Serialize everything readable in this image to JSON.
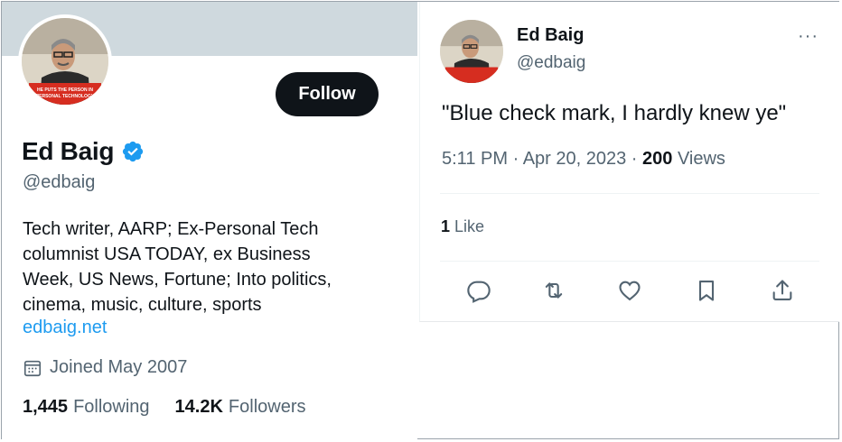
{
  "profile": {
    "name": "Ed Baig",
    "handle": "@edbaig",
    "follow_label": "Follow",
    "bio_lines": [
      "Tech writer, AARP; Ex-Personal Tech",
      "columnist USA TODAY, ex Business",
      "Week, US News, Fortune; Into politics,",
      "cinema, music, culture, sports"
    ],
    "website": "edbaig.net",
    "joined": "Joined May 2007",
    "following_count": "1,445",
    "following_label": "Following",
    "followers_count": "14.2K",
    "followers_label": "Followers",
    "avatar_caption": "HE PUTS THE PERSON IN PERSONAL TECHNOLOGY"
  },
  "tweet": {
    "name": "Ed Baig",
    "handle": "@edbaig",
    "more_label": "···",
    "text": "\"Blue check mark, I hardly knew ye\"",
    "time": "5:11 PM",
    "date": "Apr 20, 2023",
    "views_count": "200",
    "views_label": "Views",
    "likes_count": "1",
    "likes_label": "Like"
  },
  "colors": {
    "accent": "#1d9bf0",
    "text": "#0f1419",
    "muted": "#536471",
    "banner": "#cfd9de",
    "button": "#0f1419"
  },
  "icons": [
    "verified-badge-icon",
    "calendar-icon",
    "reply-icon",
    "retweet-icon",
    "like-icon",
    "bookmark-icon",
    "share-icon"
  ]
}
